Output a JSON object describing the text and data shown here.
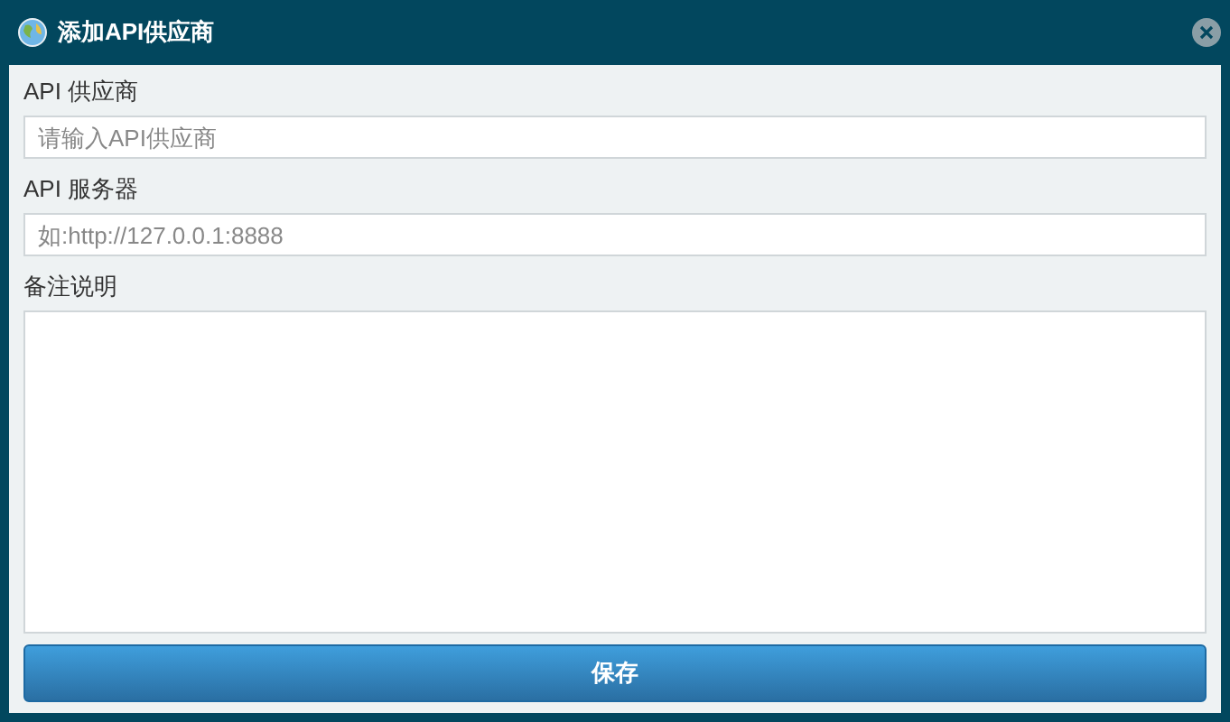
{
  "window": {
    "title": "添加API供应商"
  },
  "fields": [
    {
      "kind": "input",
      "label": "API 供应商",
      "placeholder": "请输入API供应商"
    },
    {
      "kind": "input",
      "label": "API 服务器",
      "placeholder": "如:http://127.0.0.1:8888"
    },
    {
      "kind": "textarea",
      "label": "备注说明"
    }
  ],
  "buttons": [
    "保存"
  ]
}
